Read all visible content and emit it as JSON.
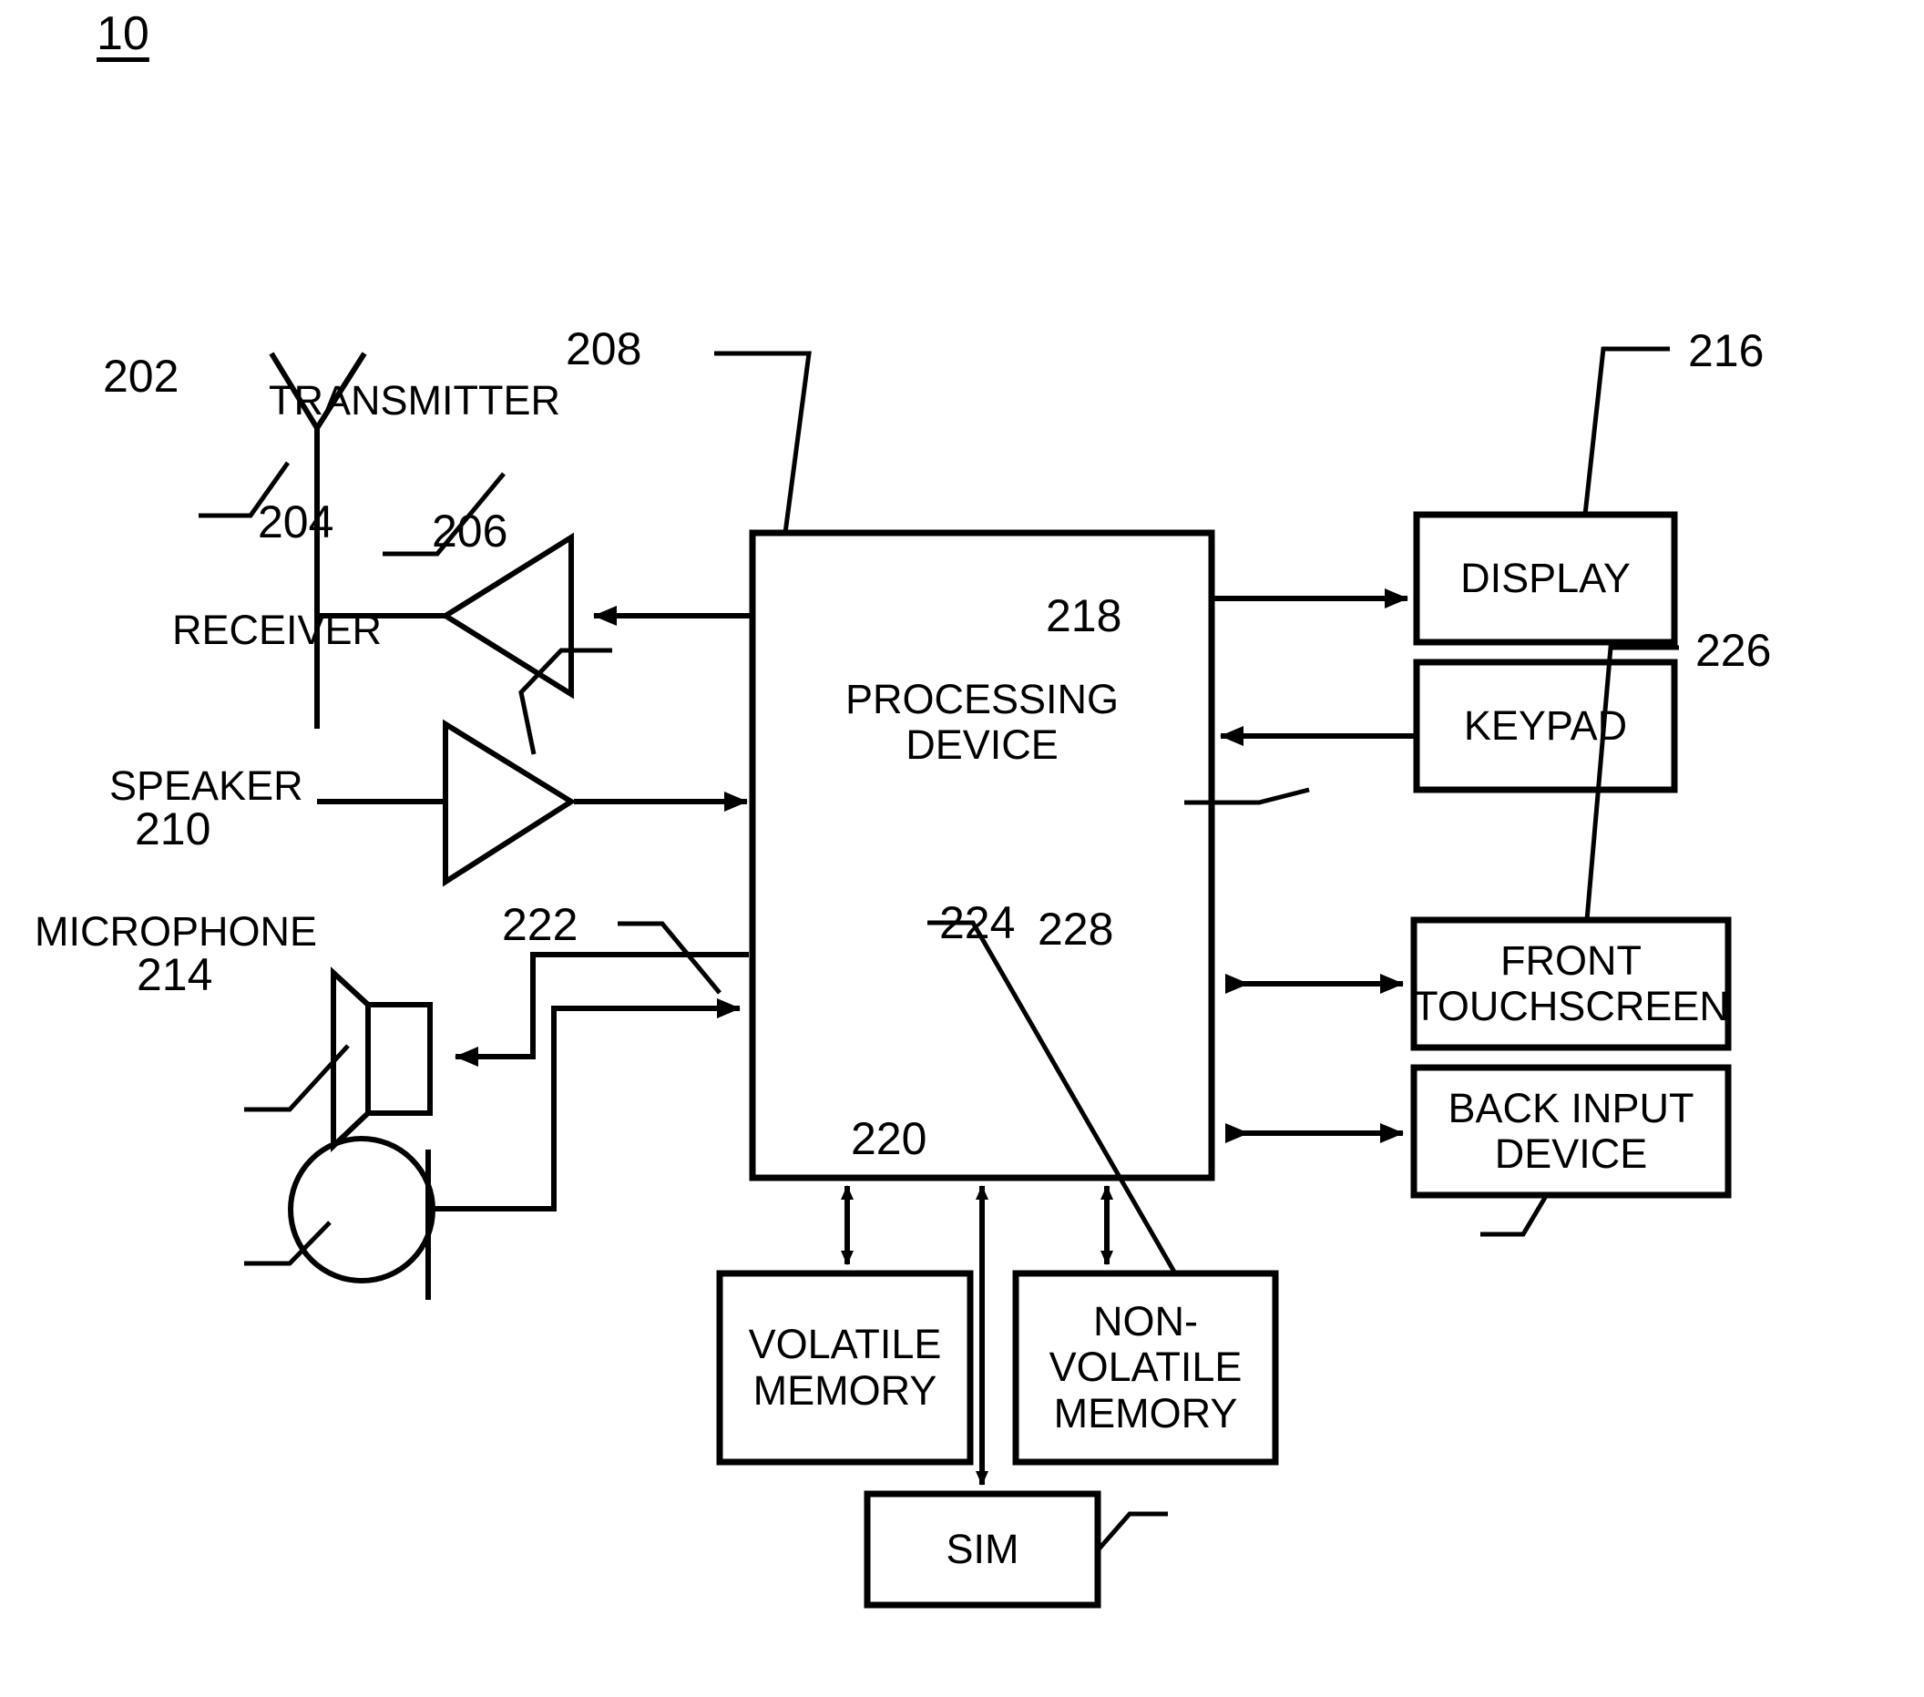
{
  "figure": {
    "number": "10",
    "title_label": "10"
  },
  "blocks": {
    "processing_device": {
      "label": "PROCESSING\nDEVICE",
      "ref": "208"
    },
    "display": {
      "label": "DISPLAY",
      "ref": "216"
    },
    "keypad": {
      "label": "KEYPAD",
      "ref": "218"
    },
    "front_touchscreen": {
      "label": "FRONT\nTOUCHSCREEN",
      "ref": "226"
    },
    "back_input_device": {
      "label": "BACK INPUT\nDEVICE",
      "ref": "228"
    },
    "volatile_memory": {
      "label": "VOLATILE\nMEMORY",
      "ref": "222"
    },
    "nonvolatile_memory": {
      "label": "NON-\nVOLATILE\nMEMORY",
      "ref": "224"
    },
    "sim": {
      "label": "SIM",
      "ref": "220"
    }
  },
  "components": {
    "antenna": {
      "label": "",
      "ref": "202"
    },
    "transmitter": {
      "label": "TRANSMITTER",
      "ref": "204"
    },
    "receiver": {
      "label": "RECEIVER",
      "ref": "206"
    },
    "speaker": {
      "label": "SPEAKER",
      "ref": "210"
    },
    "microphone": {
      "label": "MICROPHONE",
      "ref": "214"
    }
  },
  "colors": {
    "line": "#000000",
    "background": "#ffffff",
    "text": "#000000"
  }
}
